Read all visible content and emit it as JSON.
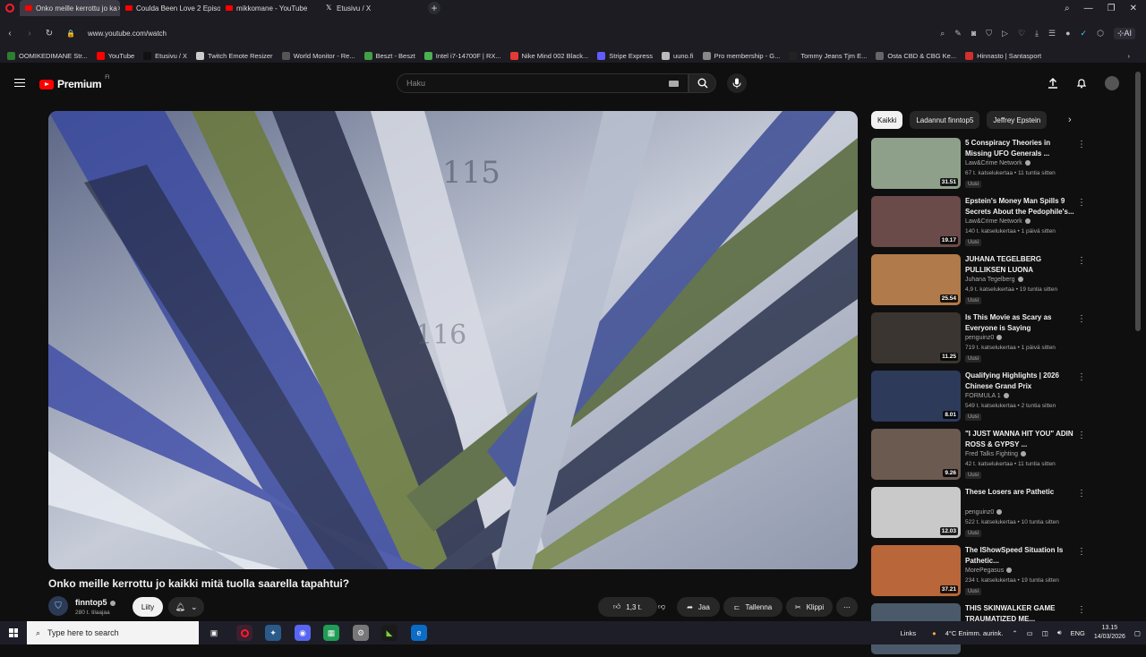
{
  "browser": {
    "tabs": [
      {
        "label": "Onko meille kerrottu jo ka",
        "active": true
      },
      {
        "label": "Coulda Been Love 2 Episo",
        "active": false
      },
      {
        "label": "mikkomane - YouTube",
        "active": false
      },
      {
        "label": "Etusivu / X",
        "active": false
      }
    ],
    "url": "www.youtube.com/watch",
    "ai_label": "AI"
  },
  "bookmarks": [
    {
      "label": "OOMIKEDIMANE Str...",
      "color": "#2e7d32"
    },
    {
      "label": "YouTube",
      "color": "#ff0000"
    },
    {
      "label": "Etusivu / X",
      "color": "#111111"
    },
    {
      "label": "Twitch Emote Resizer",
      "color": "#cccccc"
    },
    {
      "label": "World Monitor - Re...",
      "color": "#555555"
    },
    {
      "label": "Beszt - Beszt",
      "color": "#43a047"
    },
    {
      "label": "Intel i7-14700F | RX...",
      "color": "#4caf50"
    },
    {
      "label": "Nike Mind 002 Black...",
      "color": "#e53935"
    },
    {
      "label": "Stripe Express",
      "color": "#635bff"
    },
    {
      "label": "uuno.fi",
      "color": "#bbbbbb"
    },
    {
      "label": "Pro membership - G...",
      "color": "#888888"
    },
    {
      "label": "Tommy Jeans Tjm E...",
      "color": "#222222"
    },
    {
      "label": "Osta CBD & CBG Ke...",
      "color": "#666666"
    },
    {
      "label": "Hinnasto | Santasport",
      "color": "#d32f2f"
    }
  ],
  "youtube": {
    "logo_text": "Premium",
    "region": "FI",
    "search_placeholder": "Haku"
  },
  "video": {
    "title": "Onko meille kerrottu jo kaikki mitä tuolla saarella tapahtui?",
    "channel": "finntop5",
    "subscribers": "280 t. tilaajaa",
    "join_label": "Liity",
    "likes": "1,3 t.",
    "share_label": "Jaa",
    "save_label": "Tallenna",
    "clip_label": "Klippi"
  },
  "chips": [
    "Kaikki",
    "Ladannut finntop5",
    "Jeffrey Epstein"
  ],
  "recommendations": [
    {
      "title": "5 Conspiracy Theories in Missing UFO Generals ...",
      "channel": "Law&Crime Network",
      "meta": "67 t. katselukertaa • 11 tuntia sitten",
      "badge": "Uusi",
      "duration": "31.51",
      "thumb": "#8fa08a"
    },
    {
      "title": "Epstein's Money Man Spills 9 Secrets About the Pedophile's...",
      "channel": "Law&Crime Network",
      "meta": "140 t. katselukertaa • 1 päivä sitten",
      "badge": "Uusi",
      "duration": "19.17",
      "thumb": "#6b4a4a"
    },
    {
      "title": "JUHANA TEGELBERG PULLIKSEN LUONA",
      "channel": "Juhana Tegelberg",
      "meta": "4,9 t. katselukertaa • 19 tuntia sitten",
      "badge": "Uusi",
      "duration": "25.54",
      "thumb": "#b07a4a"
    },
    {
      "title": "Is This Movie as Scary as Everyone is Saying",
      "channel": "penguinz0",
      "meta": "719 t. katselukertaa • 1 päivä sitten",
      "badge": "Uusi",
      "duration": "11.25",
      "thumb": "#3a3530"
    },
    {
      "title": "Qualifying Highlights | 2026 Chinese Grand Prix",
      "channel": "FORMULA 1",
      "meta": "549 t. katselukertaa • 2 tuntia sitten",
      "badge": "Uusi",
      "duration": "8.01",
      "thumb": "#2d3a5a"
    },
    {
      "title": "\"I JUST WANNA HIT YOU\" ADIN ROSS & GYPSY ...",
      "channel": "Fred Talks Fighting",
      "meta": "42 t. katselukertaa • 11 tuntia sitten",
      "badge": "Uusi",
      "duration": "9.26",
      "thumb": "#6a5a50"
    },
    {
      "title": "These Losers are Pathetic",
      "channel": "penguinz0",
      "meta": "522 t. katselukertaa • 10 tuntia sitten",
      "badge": "Uusi",
      "duration": "12.03",
      "thumb": "#c9c9c9"
    },
    {
      "title": "The IShowSpeed Situation Is Pathetic...",
      "channel": "MorePegasus",
      "meta": "234 t. katselukertaa • 19 tuntia sitten",
      "badge": "Uusi",
      "duration": "37.21",
      "thumb": "#b8663a"
    },
    {
      "title": "THIS SKINWALKER GAME TRAUMATIZED ME...",
      "channel": "",
      "meta": "",
      "badge": "",
      "duration": "",
      "thumb": "#4a5a6a"
    }
  ],
  "taskbar": {
    "search_placeholder": "Type here to search",
    "links_label": "Links",
    "weather": "4°C  Enimm. aurink.",
    "lang": "ENG",
    "time": "13.15",
    "date": "14/03/2026"
  },
  "colors": {
    "background": "#0f0f0f",
    "accent": "#ff0000",
    "chip_selected": "#f1f1f1"
  }
}
